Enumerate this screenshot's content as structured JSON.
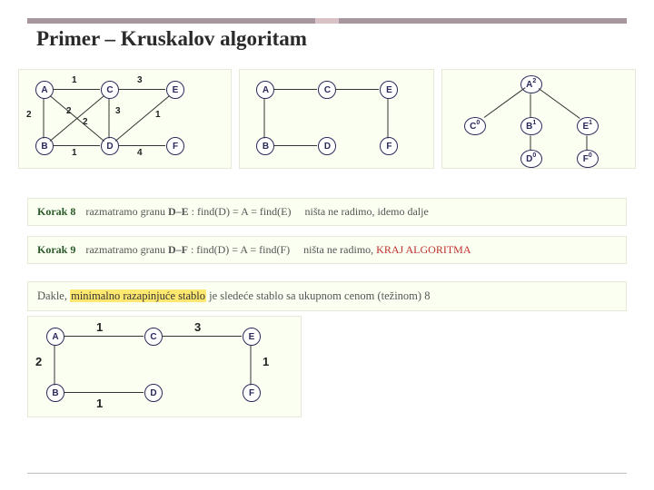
{
  "title": "Primer – Kruskalov algoritam",
  "graph1": {
    "nodes": {
      "A": "A",
      "B": "B",
      "C": "C",
      "D": "D",
      "E": "E",
      "F": "F"
    },
    "weights": {
      "AC": "1",
      "AB": "2",
      "AD": "2",
      "BC": "2",
      "BD": "1",
      "CE": "3",
      "CD": "3",
      "DE": "1",
      "DF": "4"
    }
  },
  "graph2": {
    "nodes": {
      "A": "A",
      "B": "B",
      "C": "C",
      "D": "D",
      "E": "E",
      "F": "F"
    }
  },
  "graph3": {
    "nodes": {
      "A": "A",
      "B": "B",
      "C": "C",
      "D": "D",
      "E": "E",
      "F": "F"
    },
    "sup": {
      "A": "2",
      "B": "1",
      "C": "0",
      "D": "0",
      "E": "1",
      "F": "0"
    }
  },
  "steps": {
    "s8": {
      "label": "Korak 8",
      "text": "razmatramo granu",
      "edge": "D–E",
      "eq": ": find(D) = A = find(E)",
      "note": "ništa ne radimo, idemo dalje"
    },
    "s9": {
      "label": "Korak 9",
      "text": "razmatramo granu",
      "edge": "D–F",
      "eq": ": find(D) = A = find(F)",
      "note": "ništa ne radimo,",
      "end": "KRAJ ALGORITMA"
    }
  },
  "result": {
    "pre": "Dakle,",
    "hl": "minimalno razapinjuće stablo",
    "post": "je sledeće stablo sa ukupnom cenom (težinom) 8"
  },
  "final": {
    "nodes": {
      "A": "A",
      "B": "B",
      "C": "C",
      "D": "D",
      "E": "E",
      "F": "F"
    },
    "weights": {
      "AC": "1",
      "AB": "2",
      "CE": "3",
      "EF": "1",
      "BD": "1"
    }
  },
  "chart_data": {
    "type": "diagram",
    "title": "Kruskal's algorithm example — minimum spanning tree",
    "input_graph": {
      "vertices": [
        "A",
        "B",
        "C",
        "D",
        "E",
        "F"
      ],
      "edges": [
        {
          "u": "A",
          "v": "C",
          "w": 1
        },
        {
          "u": "A",
          "v": "B",
          "w": 2
        },
        {
          "u": "A",
          "v": "D",
          "w": 2
        },
        {
          "u": "B",
          "v": "C",
          "w": 2
        },
        {
          "u": "B",
          "v": "D",
          "w": 1
        },
        {
          "u": "C",
          "v": "D",
          "w": 3
        },
        {
          "u": "C",
          "v": "E",
          "w": 3
        },
        {
          "u": "D",
          "v": "E",
          "w": 1
        },
        {
          "u": "D",
          "v": "F",
          "w": 4
        }
      ]
    },
    "mst_edges": [
      {
        "u": "A",
        "v": "C",
        "w": 1
      },
      {
        "u": "A",
        "v": "B",
        "w": 2
      },
      {
        "u": "C",
        "v": "E",
        "w": 3
      },
      {
        "u": "E",
        "v": "F",
        "w": 1
      },
      {
        "u": "B",
        "v": "D",
        "w": 1
      }
    ],
    "mst_total_weight": 8,
    "union_find_tree": {
      "root": "A",
      "children": {
        "A": [
          "C",
          "B",
          "E"
        ],
        "B": [
          "D"
        ],
        "E": [
          "F"
        ]
      },
      "ranks": {
        "A": 2,
        "B": 1,
        "C": 0,
        "D": 0,
        "E": 1,
        "F": 0
      }
    },
    "steps_shown": [
      {
        "step": 8,
        "edge": "D-E",
        "findD": "A",
        "findE": "A",
        "action": "skip"
      },
      {
        "step": 9,
        "edge": "D-F",
        "findD": "A",
        "findF": "A",
        "action": "skip — END"
      }
    ]
  }
}
